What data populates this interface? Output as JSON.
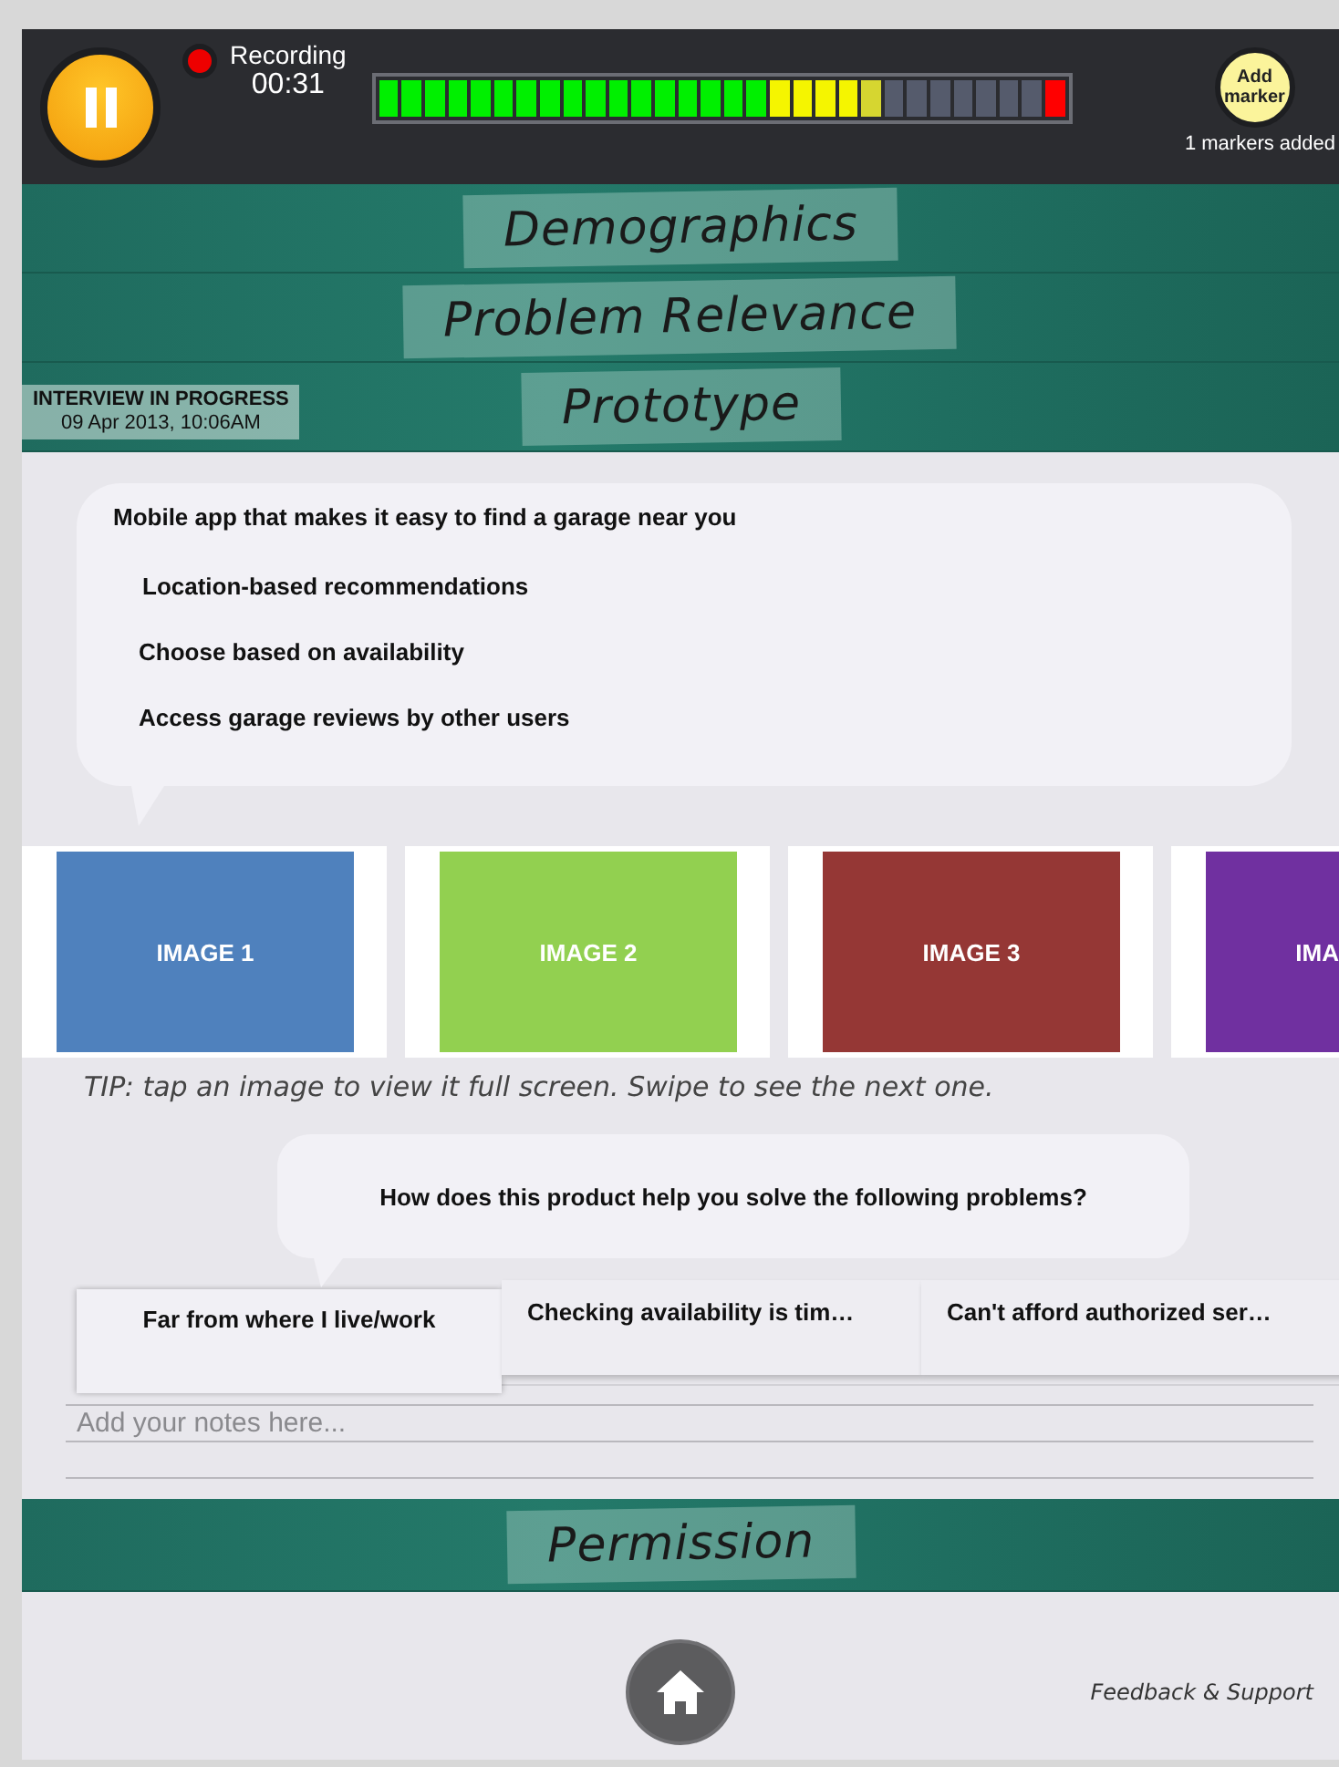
{
  "header": {
    "recording": {
      "label": "Recording",
      "time": "00:31",
      "on": true
    },
    "meter": {
      "level": 0.733,
      "clip": true
    },
    "marker_button": "Add marker",
    "marker_count": "1 markers added",
    "paused": true
  },
  "sections_above": [
    {
      "title": "Demographics"
    },
    {
      "title": "Problem Relevance"
    }
  ],
  "current_section": {
    "title": "Prototype",
    "status": "INTERVIEW IN PROGRESS",
    "date": "09 Apr 2013, 10:06AM"
  },
  "prototype": {
    "headline": "Mobile app that makes it easy to find a garage near you",
    "features": [
      "Location-based recommendations",
      "Choose based on availability",
      "Access garage reviews by other users"
    ],
    "images": [
      {
        "label": "IMAGE 1",
        "color": "#4f81bd"
      },
      {
        "label": "IMAGE 2",
        "color": "#92d050"
      },
      {
        "label": "IMAGE 3",
        "color": "#953735"
      },
      {
        "label": "IMA",
        "color": "#7030a0"
      }
    ],
    "tip": "TIP: tap an image to view it full screen. Swipe to see the next one.",
    "question": "How does this product help you solve the following problems?",
    "problems": [
      {
        "label": "Far from where I live/work",
        "selected": true
      },
      {
        "label": "Checking availability is tim…",
        "selected": false
      },
      {
        "label": "Can't afford authorized ser…",
        "selected": false
      }
    ],
    "notes": {
      "placeholder": "Add your notes here..."
    }
  },
  "sections_below": [
    {
      "title": "Permission"
    }
  ],
  "footer": {
    "link": "Feedback & Support"
  }
}
